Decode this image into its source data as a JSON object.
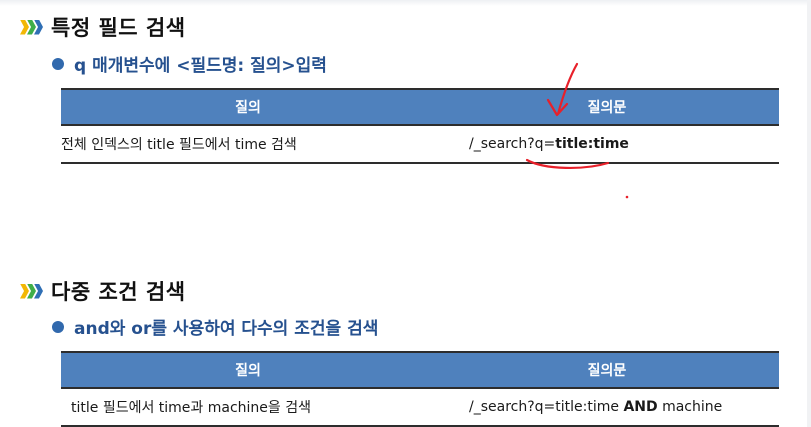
{
  "sections": [
    {
      "title": "특정 필드 검색",
      "bullet": "q 매개변수에 <필드명: 질의>입력",
      "table": {
        "headers": [
          "질의",
          "질의문"
        ],
        "row": {
          "query": "전체 인덱스의 title 필드에서 time 검색",
          "statement_prefix": "/_search?q=",
          "statement_bold": "title:time",
          "statement_suffix": ""
        }
      }
    },
    {
      "title": "다중 조건 검색",
      "bullet": "and와 or를 사용하여 다수의 조건을 검색",
      "table": {
        "headers": [
          "질의",
          "질의문"
        ],
        "row": {
          "query": "title 필드에서 time과 machine을 검색",
          "statement_prefix": "/_search?q=title:time ",
          "statement_bold": "AND",
          "statement_suffix": " machine"
        }
      }
    }
  ],
  "colors": {
    "header_bg": "#4f81bd",
    "bullet_text": "#26518f",
    "bullet_dot": "#3169ad",
    "chevron": [
      "#f2b705",
      "#3fae49",
      "#2f6fb5"
    ],
    "annotation": "#e8202a"
  }
}
